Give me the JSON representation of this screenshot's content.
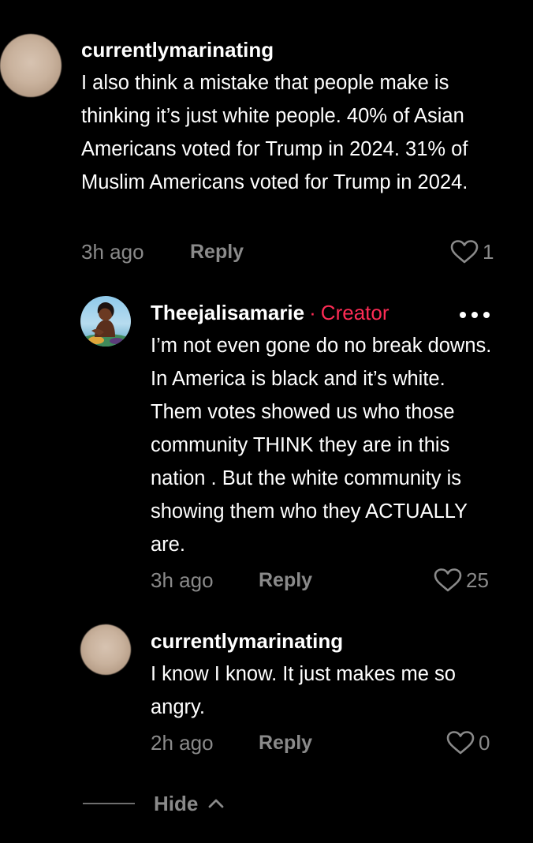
{
  "comments": [
    {
      "username": "currentlymarinating",
      "text": "I also think a mistake that people make is thinking it’s just white people. 40% of Asian Americans voted for Trump in 2024. 31% of Muslim Americans voted for Trump in 2024.",
      "time": "3h ago",
      "reply_label": "Reply",
      "likes": "1",
      "avatar_icon": "blurred-avatar"
    },
    {
      "username": "Theejalisamarie",
      "separator": "·",
      "badge": "Creator",
      "text": "I’m not even gone do no break downs. In America is black and it’s white. Them votes showed us who those community THINK they are in this nation . But the white community is showing them who they ACTUALLY are.",
      "time": "3h ago",
      "reply_label": "Reply",
      "likes": "25",
      "avatar_icon": "illustrated-avatar",
      "more_icon": "more-options-icon"
    },
    {
      "username": "currentlymarinating",
      "text": "I know I know. It just makes me so angry.",
      "time": "2h ago",
      "reply_label": "Reply",
      "likes": "0",
      "avatar_icon": "blurred-avatar"
    }
  ],
  "hide": {
    "label": "Hide",
    "icon": "chevron-up-icon"
  },
  "colors": {
    "background": "#000000",
    "text": "#ffffff",
    "muted": "#8a8a8a",
    "creator": "#fe2c55"
  }
}
